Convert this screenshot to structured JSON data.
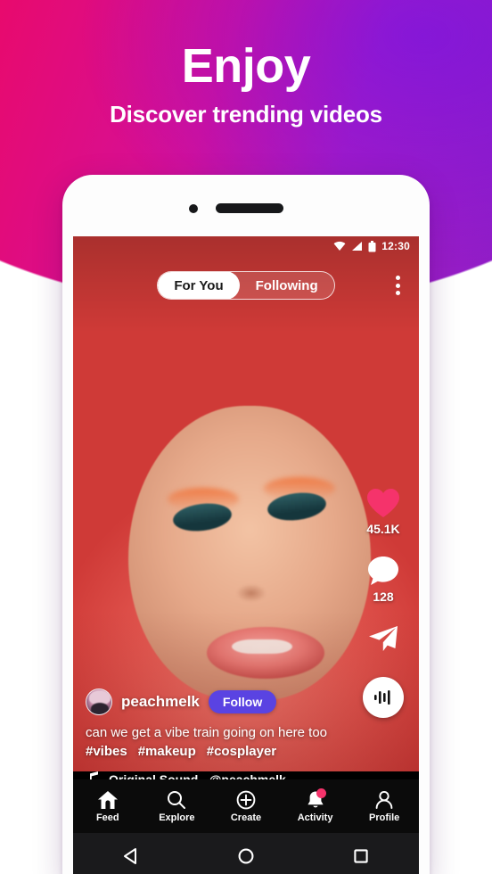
{
  "hero": {
    "title": "Enjoy",
    "subtitle": "Discover trending videos",
    "gradient_start": "#e80a6d",
    "gradient_end": "#8a1ec8"
  },
  "phone": {
    "status_bar": {
      "time": "12:30",
      "icons": [
        "wifi-icon",
        "signal-icon",
        "battery-icon"
      ]
    },
    "tabs": [
      {
        "label": "For You",
        "active": true
      },
      {
        "label": "Following",
        "active": false
      }
    ],
    "overflow_menu_icon": "kebab-menu-icon",
    "actions": {
      "like": {
        "icon": "heart-icon",
        "count": "45.1K",
        "color": "#f5336b"
      },
      "comment": {
        "icon": "comment-icon",
        "count": "128"
      },
      "share": {
        "icon": "send-icon"
      },
      "audio": {
        "icon": "audio-wave-icon"
      }
    },
    "post": {
      "username": "peachmelk",
      "follow_label": "Follow",
      "follow_color": "#5a43e2",
      "caption": "can we get a vibe train going on here too",
      "hashtags": [
        "#vibes",
        "#makeup",
        "#cosplayer"
      ],
      "sound_icon": "music-note-icon",
      "sound_title": "Original Sound - @peachmelk"
    },
    "bottom_nav": [
      {
        "label": "Feed",
        "icon": "home-icon",
        "active": true,
        "badge": false
      },
      {
        "label": "Explore",
        "icon": "search-icon",
        "active": false,
        "badge": false
      },
      {
        "label": "Create",
        "icon": "plus-circle-icon",
        "active": false,
        "badge": false
      },
      {
        "label": "Activity",
        "icon": "bell-icon",
        "active": false,
        "badge": true
      },
      {
        "label": "Profile",
        "icon": "person-icon",
        "active": false,
        "badge": false
      }
    ],
    "system_nav": [
      {
        "icon": "back-triangle-icon"
      },
      {
        "icon": "home-circle-icon"
      },
      {
        "icon": "recents-square-icon"
      }
    ]
  }
}
